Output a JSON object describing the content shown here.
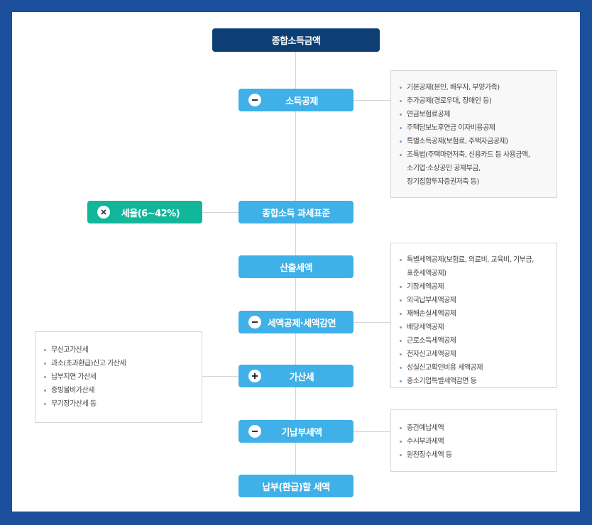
{
  "flow": {
    "top": "종합소득금액",
    "income_deduction": "소득공제",
    "tax_base": "종합소득 과세표준",
    "tax_rate": "세율(6~42%)",
    "calculated_tax": "산출세액",
    "tax_credit": "세액공제·세액감면",
    "additional_tax": "가산세",
    "prepaid_tax": "기납부세액",
    "payable_tax": "납부(환급)할 세액"
  },
  "icons": {
    "income_deduction": "minus-icon",
    "tax_rate": "times-icon",
    "tax_credit": "minus-icon",
    "additional_tax": "plus-icon",
    "prepaid_tax": "minus-icon"
  },
  "colors": {
    "background": "#1c4f9c",
    "top_node": "#0d3e74",
    "step_node": "#3fb0e8",
    "rate_node": "#12b79b"
  },
  "income_deduction_items": [
    "기본공제(본인, 배우자, 부양가족)",
    "추가공제(경로우대, 장애인 등)",
    "연금보험료공제",
    "주택담보노후연금 이자비용공제",
    "특별소득공제(보험료, 주택자금공제)",
    "조특법(주택마련저축, 신용카드 등 사용금액,\n소기업·소상공인 공제부금,\n장기집합투자증권저축 등)"
  ],
  "tax_credit_items": [
    "특별세액공제(보험료, 의료비, 교육비, 기부금,\n표준세액공제)",
    "기장세액공제",
    "외국납부세액공제",
    "재해손실세액공제",
    "배당세액공제",
    "근로소득세액공제",
    "전자신고세액공제",
    "성실신고확인비용 세액공제",
    "중소기업특별세액감면 등"
  ],
  "additional_tax_items": [
    "무신고가산세",
    "과소(초과환급)신고 가산세",
    "납부지연 가산세",
    "증빙불비가산세",
    "무기장가산세 등"
  ],
  "prepaid_tax_items": [
    "중간예납세액",
    "수시부과세액",
    "원천징수세액 등"
  ]
}
